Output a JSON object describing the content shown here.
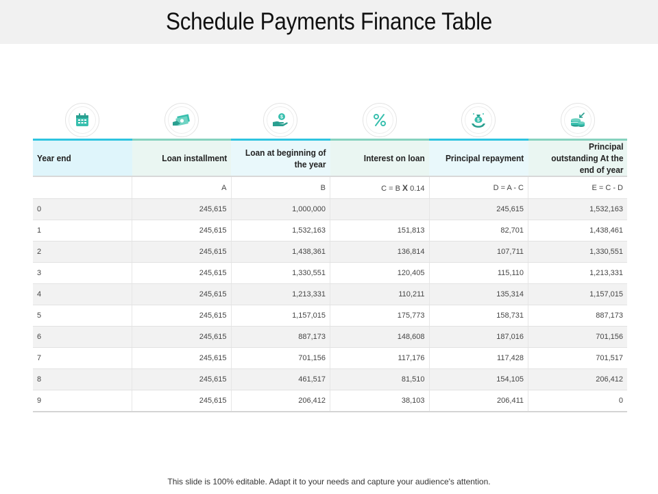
{
  "page": {
    "title": "Schedule Payments Finance Table",
    "footer": "This slide is 100% editable. Adapt it to your needs and capture your audience's attention."
  },
  "icons": [
    "calendar-icon",
    "cash-icon",
    "money-hand-icon",
    "percent-icon",
    "money-bag-hand-icon",
    "coins-icon"
  ],
  "colors": {
    "accent_blue": "#2ec4e0",
    "accent_green": "#86d2be",
    "icon_teal": "#38bfae"
  },
  "table": {
    "headers": [
      "Year end",
      "Loan installment",
      "Loan at beginning of the year",
      "Interest on loan",
      "Principal repayment",
      "Principal outstanding At the end of year"
    ],
    "formula": {
      "a": "A",
      "b": "B",
      "c_pre": "C = B ",
      "c_x": "X",
      "c_post": " 0.14",
      "d": "D = A - C",
      "e": "E = C - D"
    },
    "rows": [
      [
        "0",
        "245,615",
        "1,000,000",
        "",
        "245,615",
        "1,532,163"
      ],
      [
        "1",
        "245,615",
        "1,532,163",
        "151,813",
        "82,701",
        "1,438,461"
      ],
      [
        "2",
        "245,615",
        "1,438,361",
        "136,814",
        "107,711",
        "1,330,551"
      ],
      [
        "3",
        "245,615",
        "1,330,551",
        "120,405",
        "115,110",
        "1,213,331"
      ],
      [
        "4",
        "245,615",
        "1,213,331",
        "110,211",
        "135,314",
        "1,157,015"
      ],
      [
        "5",
        "245,615",
        "1,157,015",
        "175,773",
        "158,731",
        "887,173"
      ],
      [
        "6",
        "245,615",
        "887,173",
        "148,608",
        "187,016",
        "701,156"
      ],
      [
        "7",
        "245,615",
        "701,156",
        "117,176",
        "117,428",
        "701,517"
      ],
      [
        "8",
        "245,615",
        "461,517",
        "81,510",
        "154,105",
        "206,412"
      ],
      [
        "9",
        "245,615",
        "206,412",
        "38,103",
        "206,411",
        "0"
      ]
    ]
  }
}
